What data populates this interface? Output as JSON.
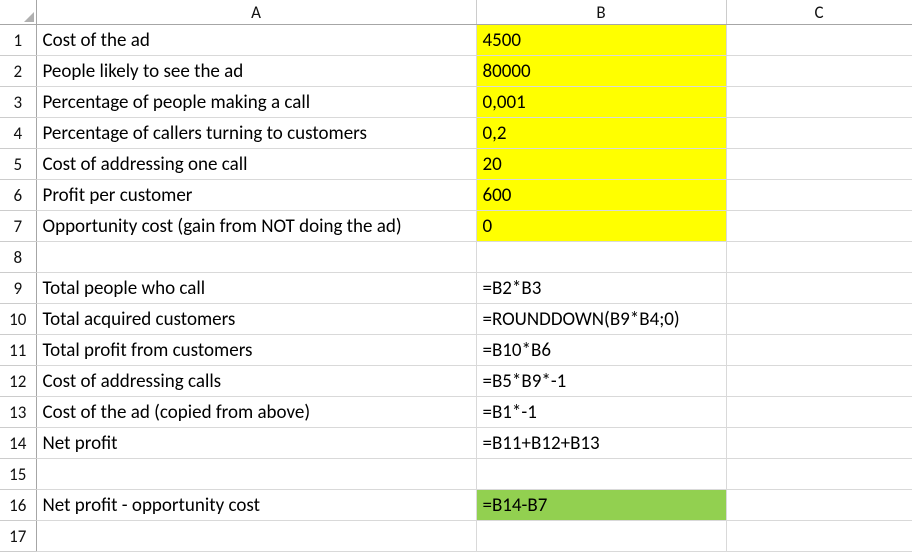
{
  "columns": {
    "A": "A",
    "B": "B",
    "C": "C"
  },
  "rows": {
    "1": {
      "A": "Cost of the ad",
      "B": "4500"
    },
    "2": {
      "A": "People likely to see the ad",
      "B": "80000"
    },
    "3": {
      "A": "Percentage of people making a call",
      "B": "0,001"
    },
    "4": {
      "A": "Percentage of callers turning to customers",
      "B": "0,2"
    },
    "5": {
      "A": "Cost of addressing one call",
      "B": "20"
    },
    "6": {
      "A": "Profit per customer",
      "B": "600"
    },
    "7": {
      "A": "Opportunity cost (gain from NOT doing the ad)",
      "B": "0"
    },
    "8": {
      "A": "",
      "B": ""
    },
    "9": {
      "A": "Total people who call",
      "B": "=B2*B3"
    },
    "10": {
      "A": "Total acquired customers",
      "B": "=ROUNDDOWN(B9*B4;0)"
    },
    "11": {
      "A": "Total profit from customers",
      "B": "=B10*B6"
    },
    "12": {
      "A": "Cost of addressing calls",
      "B": "=B5*B9*-1"
    },
    "13": {
      "A": "Cost of the ad (copied from above)",
      "B": "=B1*-1"
    },
    "14": {
      "A": "Net profit",
      "B": "=B11+B12+B13"
    },
    "15": {
      "A": "",
      "B": ""
    },
    "16": {
      "A": "Net profit - opportunity cost",
      "B": "=B14-B7"
    },
    "17": {
      "A": "",
      "B": ""
    }
  },
  "chart_data": {
    "type": "table",
    "title": "Ad profitability calculation",
    "inputs": {
      "cost_of_ad": 4500,
      "people_likely_to_see_ad": 80000,
      "pct_people_making_a_call": 0.001,
      "pct_callers_turning_to_customers": 0.2,
      "cost_of_addressing_one_call": 20,
      "profit_per_customer": 600,
      "opportunity_cost": 0
    },
    "formulas": {
      "total_people_who_call": "=B2*B3",
      "total_acquired_customers": "=ROUNDDOWN(B9*B4;0)",
      "total_profit_from_customers": "=B10*B6",
      "cost_of_addressing_calls": "=B5*B9*-1",
      "cost_of_the_ad_copied": "=B1*-1",
      "net_profit": "=B11+B12+B13",
      "net_profit_minus_opportunity_cost": "=B14-B7"
    }
  }
}
